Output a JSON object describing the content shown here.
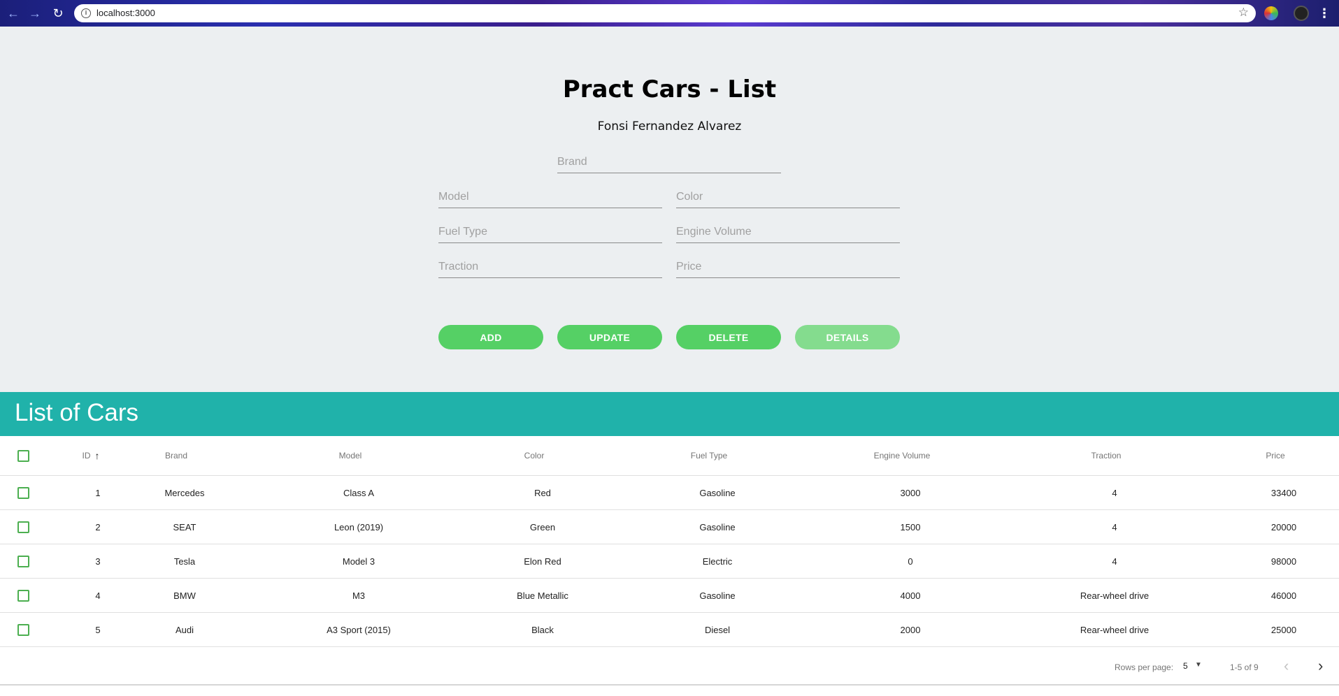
{
  "browser": {
    "url": "localhost:3000"
  },
  "app": {
    "title": "Pract Cars - List",
    "subtitle": "Fonsi Fernandez Alvarez"
  },
  "form": {
    "brand_placeholder": "Brand",
    "model_placeholder": "Model",
    "color_placeholder": "Color",
    "fuel_placeholder": "Fuel Type",
    "engine_placeholder": "Engine Volume",
    "traction_placeholder": "Traction",
    "price_placeholder": "Price"
  },
  "buttons": {
    "add": "ADD",
    "update": "UPDATE",
    "delete": "DELETE",
    "details": "DETAILS"
  },
  "list": {
    "title": "List of Cars",
    "columns": {
      "id": "ID",
      "brand": "Brand",
      "model": "Model",
      "color": "Color",
      "fuel": "Fuel Type",
      "engine": "Engine Volume",
      "traction": "Traction",
      "price": "Price"
    },
    "rows": [
      {
        "id": "1",
        "brand": "Mercedes",
        "model": "Class A",
        "color": "Red",
        "fuel": "Gasoline",
        "engine": "3000",
        "traction": "4",
        "price": "33400"
      },
      {
        "id": "2",
        "brand": "SEAT",
        "model": "Leon (2019)",
        "color": "Green",
        "fuel": "Gasoline",
        "engine": "1500",
        "traction": "4",
        "price": "20000"
      },
      {
        "id": "3",
        "brand": "Tesla",
        "model": "Model 3",
        "color": "Elon Red",
        "fuel": "Electric",
        "engine": "0",
        "traction": "4",
        "price": "98000"
      },
      {
        "id": "4",
        "brand": "BMW",
        "model": "M3",
        "color": "Blue Metallic",
        "fuel": "Gasoline",
        "engine": "4000",
        "traction": "Rear-wheel drive",
        "price": "46000"
      },
      {
        "id": "5",
        "brand": "Audi",
        "model": "A3 Sport (2015)",
        "color": "Black",
        "fuel": "Diesel",
        "engine": "2000",
        "traction": "Rear-wheel drive",
        "price": "25000"
      }
    ]
  },
  "pagination": {
    "rows_per_page_label": "Rows per page:",
    "rows_per_page_value": "5",
    "range": "1-5 of 9"
  },
  "icons": {
    "sort": "arrow-up-icon",
    "prev": "chevron-left-icon",
    "next": "chevron-right-icon"
  },
  "colors": {
    "accent_green": "#55d065",
    "band_teal": "#20b2aa",
    "form_bg": "#eceff1"
  }
}
